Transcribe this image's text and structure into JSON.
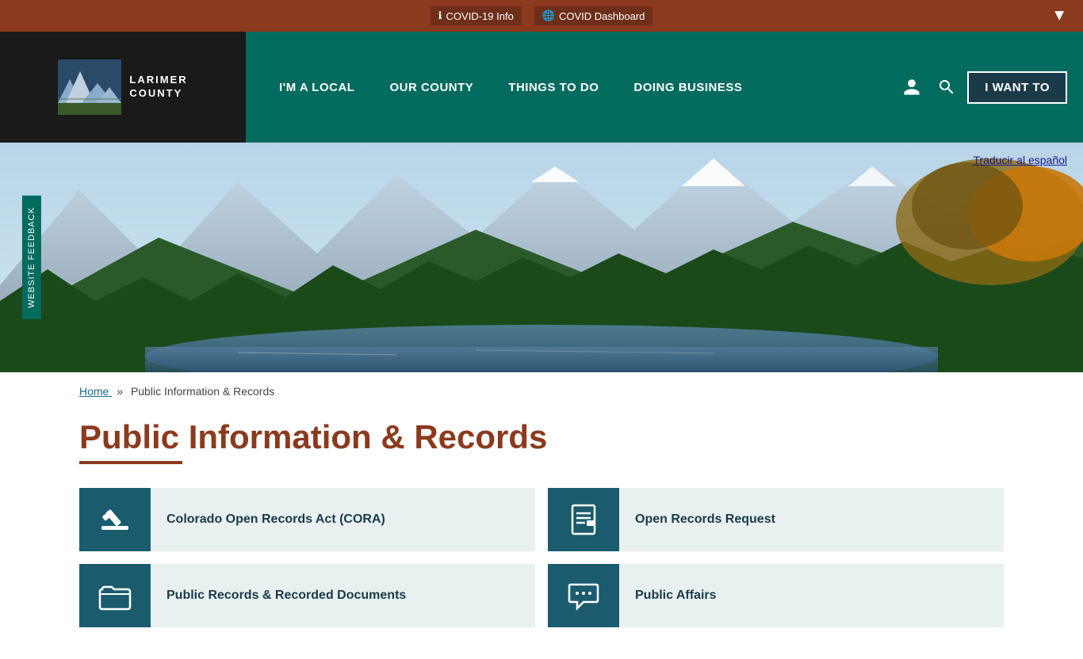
{
  "alert_bar": {
    "covid_info_label": "COVID-19 Info",
    "covid_dashboard_label": "COVID Dashboard"
  },
  "header": {
    "logo_line1": "LARIMER",
    "logo_line2": "COUNTY",
    "nav_items": [
      {
        "label": "I'M A LOCAL",
        "id": "im-a-local"
      },
      {
        "label": "OUR COUNTY",
        "id": "our-county"
      },
      {
        "label": "THINGS TO DO",
        "id": "things-to-do"
      },
      {
        "label": "DOING BUSINESS",
        "id": "doing-business"
      }
    ],
    "i_want_to_label": "I WANT TO"
  },
  "hero": {
    "translate_label": "Traducir al español",
    "feedback_label": "Website Feedback"
  },
  "breadcrumb": {
    "home_label": "Home",
    "separator": "»",
    "current": "Public Information & Records"
  },
  "page": {
    "title": "Public Information & Records",
    "cards": [
      {
        "id": "cora",
        "label": "Colorado Open Records Act (CORA)",
        "icon": "gavel"
      },
      {
        "id": "open-records-request",
        "label": "Open Records Request",
        "icon": "list-doc"
      },
      {
        "id": "public-records",
        "label": "Public Records & Recorded Documents",
        "icon": "folder"
      },
      {
        "id": "public-affairs",
        "label": "Public Affairs",
        "icon": "chat"
      }
    ]
  },
  "colors": {
    "header_bg": "#006B5E",
    "logo_bg": "#1a1a1a",
    "alert_bg": "#8B3A1E",
    "card_icon_bg": "#1a5c6e",
    "card_bg": "#e8f0f0",
    "title_color": "#8B3A1E"
  }
}
